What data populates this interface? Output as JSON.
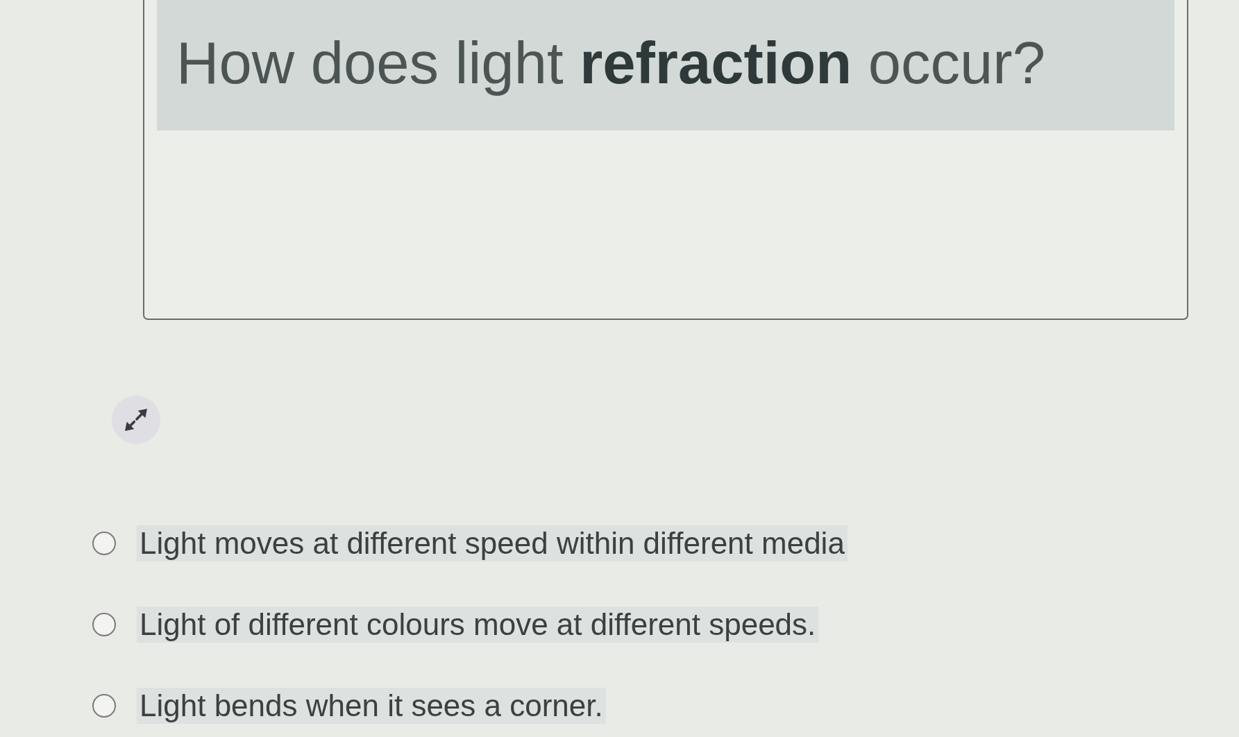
{
  "question": {
    "text": "How does light **refraction** occur?"
  },
  "options": [
    {
      "label": "Light moves at different speed within different media",
      "selected": false
    },
    {
      "label": "Light of different colours move at different speeds.",
      "selected": false
    },
    {
      "label": "Light bends when it sees a corner.",
      "selected": false
    }
  ]
}
